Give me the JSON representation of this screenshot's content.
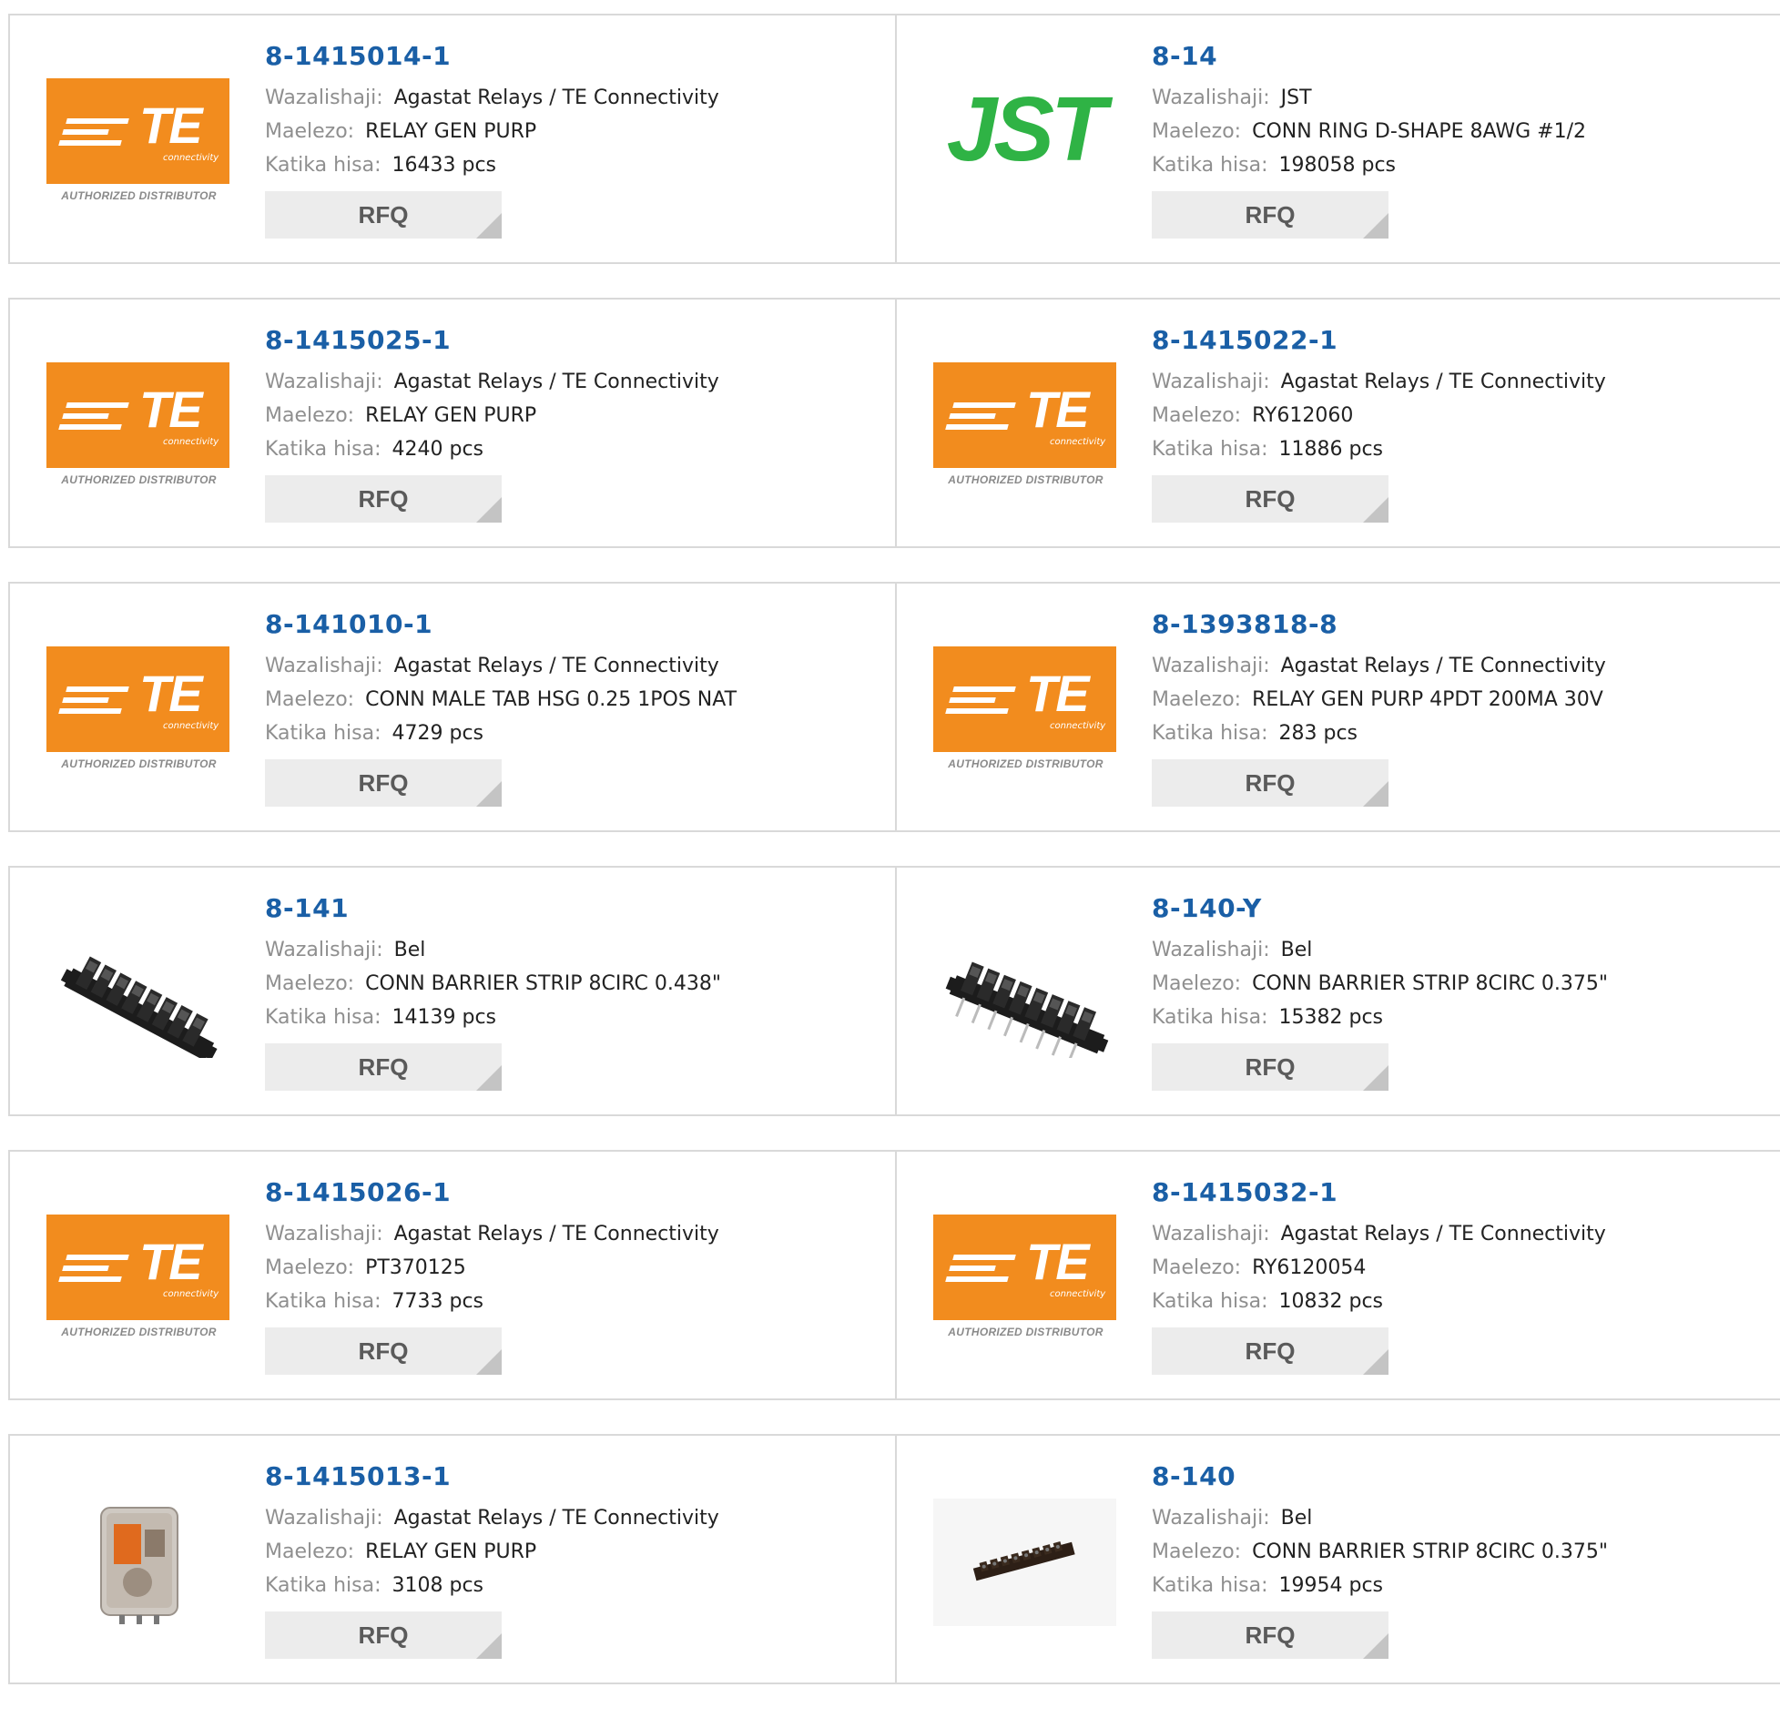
{
  "labels": {
    "manufacturer": "Wazalishaji:",
    "description": "Maelezo:",
    "stock": "Katika hisa:",
    "rfq": "RFQ",
    "te_letters": "TE",
    "te_sub": "connectivity",
    "te_authorized": "AUTHORIZED DISTRIBUTOR",
    "jst_logo": "JST"
  },
  "colors": {
    "part_link": "#1a5fa6",
    "te_orange": "#f28c1e",
    "jst_green": "#2fb345",
    "rfq_bg": "#ececec"
  },
  "products": [
    {
      "part": "8-1415014-1",
      "manufacturer": "Agastat Relays / TE Connectivity",
      "description": "RELAY GEN PURP",
      "stock": "16433 pcs",
      "image": "te-logo"
    },
    {
      "part": "8-14",
      "manufacturer": "JST",
      "description": "CONN RING D-SHAPE 8AWG #1/2",
      "stock": "198058 pcs",
      "image": "jst-logo"
    },
    {
      "part": "8-1415025-1",
      "manufacturer": "Agastat Relays / TE Connectivity",
      "description": "RELAY GEN PURP",
      "stock": "4240 pcs",
      "image": "te-logo"
    },
    {
      "part": "8-1415022-1",
      "manufacturer": "Agastat Relays / TE Connectivity",
      "description": "RY612060",
      "stock": "11886 pcs",
      "image": "te-logo"
    },
    {
      "part": "8-141010-1",
      "manufacturer": "Agastat Relays / TE Connectivity",
      "description": "CONN MALE TAB HSG 0.25 1POS NAT",
      "stock": "4729 pcs",
      "image": "te-logo"
    },
    {
      "part": "8-1393818-8",
      "manufacturer": "Agastat Relays / TE Connectivity",
      "description": "RELAY GEN PURP 4PDT 200MA 30V",
      "stock": "283 pcs",
      "image": "te-logo"
    },
    {
      "part": "8-141",
      "manufacturer": "Bel",
      "description": "CONN BARRIER STRIP 8CIRC 0.438\"",
      "stock": "14139 pcs",
      "image": "barrier-strip-photo"
    },
    {
      "part": "8-140-Y",
      "manufacturer": "Bel",
      "description": "CONN BARRIER STRIP 8CIRC 0.375\"",
      "stock": "15382 pcs",
      "image": "barrier-strip-pcb-photo"
    },
    {
      "part": "8-1415026-1",
      "manufacturer": "Agastat Relays / TE Connectivity",
      "description": "PT370125",
      "stock": "7733 pcs",
      "image": "te-logo"
    },
    {
      "part": "8-1415032-1",
      "manufacturer": "Agastat Relays / TE Connectivity",
      "description": "RY6120054",
      "stock": "10832 pcs",
      "image": "te-logo"
    },
    {
      "part": "8-1415013-1",
      "manufacturer": "Agastat Relays / TE Connectivity",
      "description": "RELAY GEN PURP",
      "stock": "3108 pcs",
      "image": "relay-photo"
    },
    {
      "part": "8-140",
      "manufacturer": "Bel",
      "description": "CONN BARRIER STRIP 8CIRC 0.375\"",
      "stock": "19954 pcs",
      "image": "small-barrier-strip-photo"
    }
  ]
}
